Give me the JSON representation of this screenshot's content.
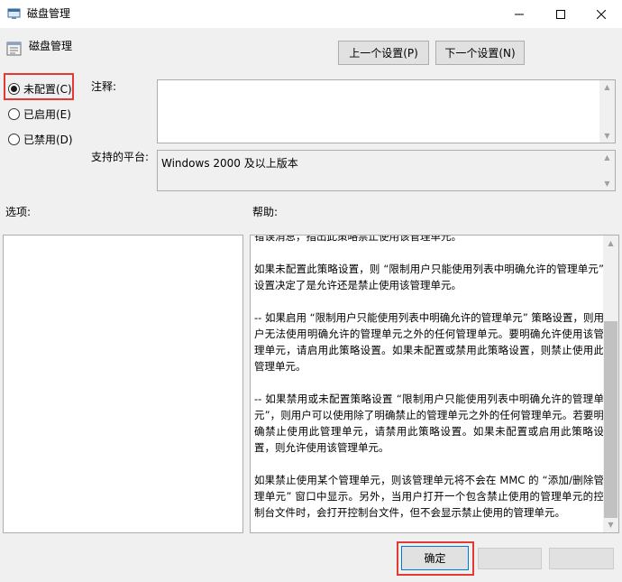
{
  "window": {
    "title": "磁盘管理",
    "controls": {
      "minimize": "—",
      "maximize": "☐",
      "close": "✕"
    }
  },
  "setting": {
    "title": "磁盘管理",
    "prev_label": "上一个设置(P)",
    "next_label": "下一个设置(N)"
  },
  "state": {
    "options": [
      {
        "label": "未配置(C)",
        "checked": true
      },
      {
        "label": "已启用(E)",
        "checked": false
      },
      {
        "label": "已禁用(D)",
        "checked": false
      }
    ]
  },
  "comment": {
    "label": "注释:",
    "value": ""
  },
  "platform": {
    "label": "支持的平台:",
    "value": "Windows 2000 及以上版本"
  },
  "options_label": "选项:",
  "help_label": "帮助:",
  "help": {
    "paragraphs": [
      "错误消息，指出此策略禁止使用该管理单元。",
      "如果未配置此策略设置，则 “限制用户只能使用列表中明确允许的管理单元” 设置决定了是允许还是禁止使用该管理单元。",
      "-- 如果启用 “限制用户只能使用列表中明确允许的管理单元” 策略设置，则用户无法使用明确允许的管理单元之外的任何管理单元。要明确允许使用该管理单元，请启用此策略设置。如果未配置或禁用此策略设置，则禁止使用此管理单元。",
      "-- 如果禁用或未配置策略设置 “限制用户只能使用列表中明确允许的管理单元”，则用户可以使用除了明确禁止的管理单元之外的任何管理单元。若要明确禁止使用此管理单元，请禁用此策略设置。如果未配置或启用此策略设置，则允许使用该管理单元。",
      "如果禁止使用某个管理单元，则该管理单元将不会在 MMC 的 “添加/删除管理单元” 窗口中显示。另外，当用户打开一个包含禁止使用的管理单元的控制台文件时，会打开控制台文件，但不会显示禁止使用的管理单元。"
    ]
  },
  "buttons": {
    "ok": "确定",
    "cancel": "",
    "apply": ""
  },
  "colors": {
    "highlight": "#e53935",
    "focus": "#0078d7"
  }
}
